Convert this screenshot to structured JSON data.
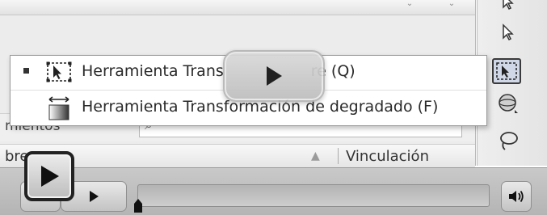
{
  "menu": {
    "items": [
      {
        "label": "Herramienta Transformación libre (Q)",
        "label_visible_start": "Herramienta Trans",
        "label_visible_end": "re (Q)",
        "checked": true,
        "icon": "free-transform-icon"
      },
      {
        "label": "Herramienta Transformación de degradado (F)",
        "checked": false,
        "icon": "gradient-transform-icon"
      }
    ]
  },
  "panel": {
    "properties_label": "mientos",
    "table": {
      "col_name": "bre",
      "col_vinculacion": "Vinculación"
    }
  },
  "tools": [
    {
      "icon": "selection-arrow-icon"
    },
    {
      "icon": "subselection-arrow-icon"
    },
    {
      "icon": "free-transform-icon",
      "active": true
    },
    {
      "icon": "3d-rotation-icon"
    },
    {
      "icon": "lasso-icon"
    }
  ],
  "player": {
    "progress": 0.0
  },
  "colors": {
    "background": "#ececec",
    "player_bar": "#bfbfbf",
    "active_tool": "#d0d8e8"
  }
}
